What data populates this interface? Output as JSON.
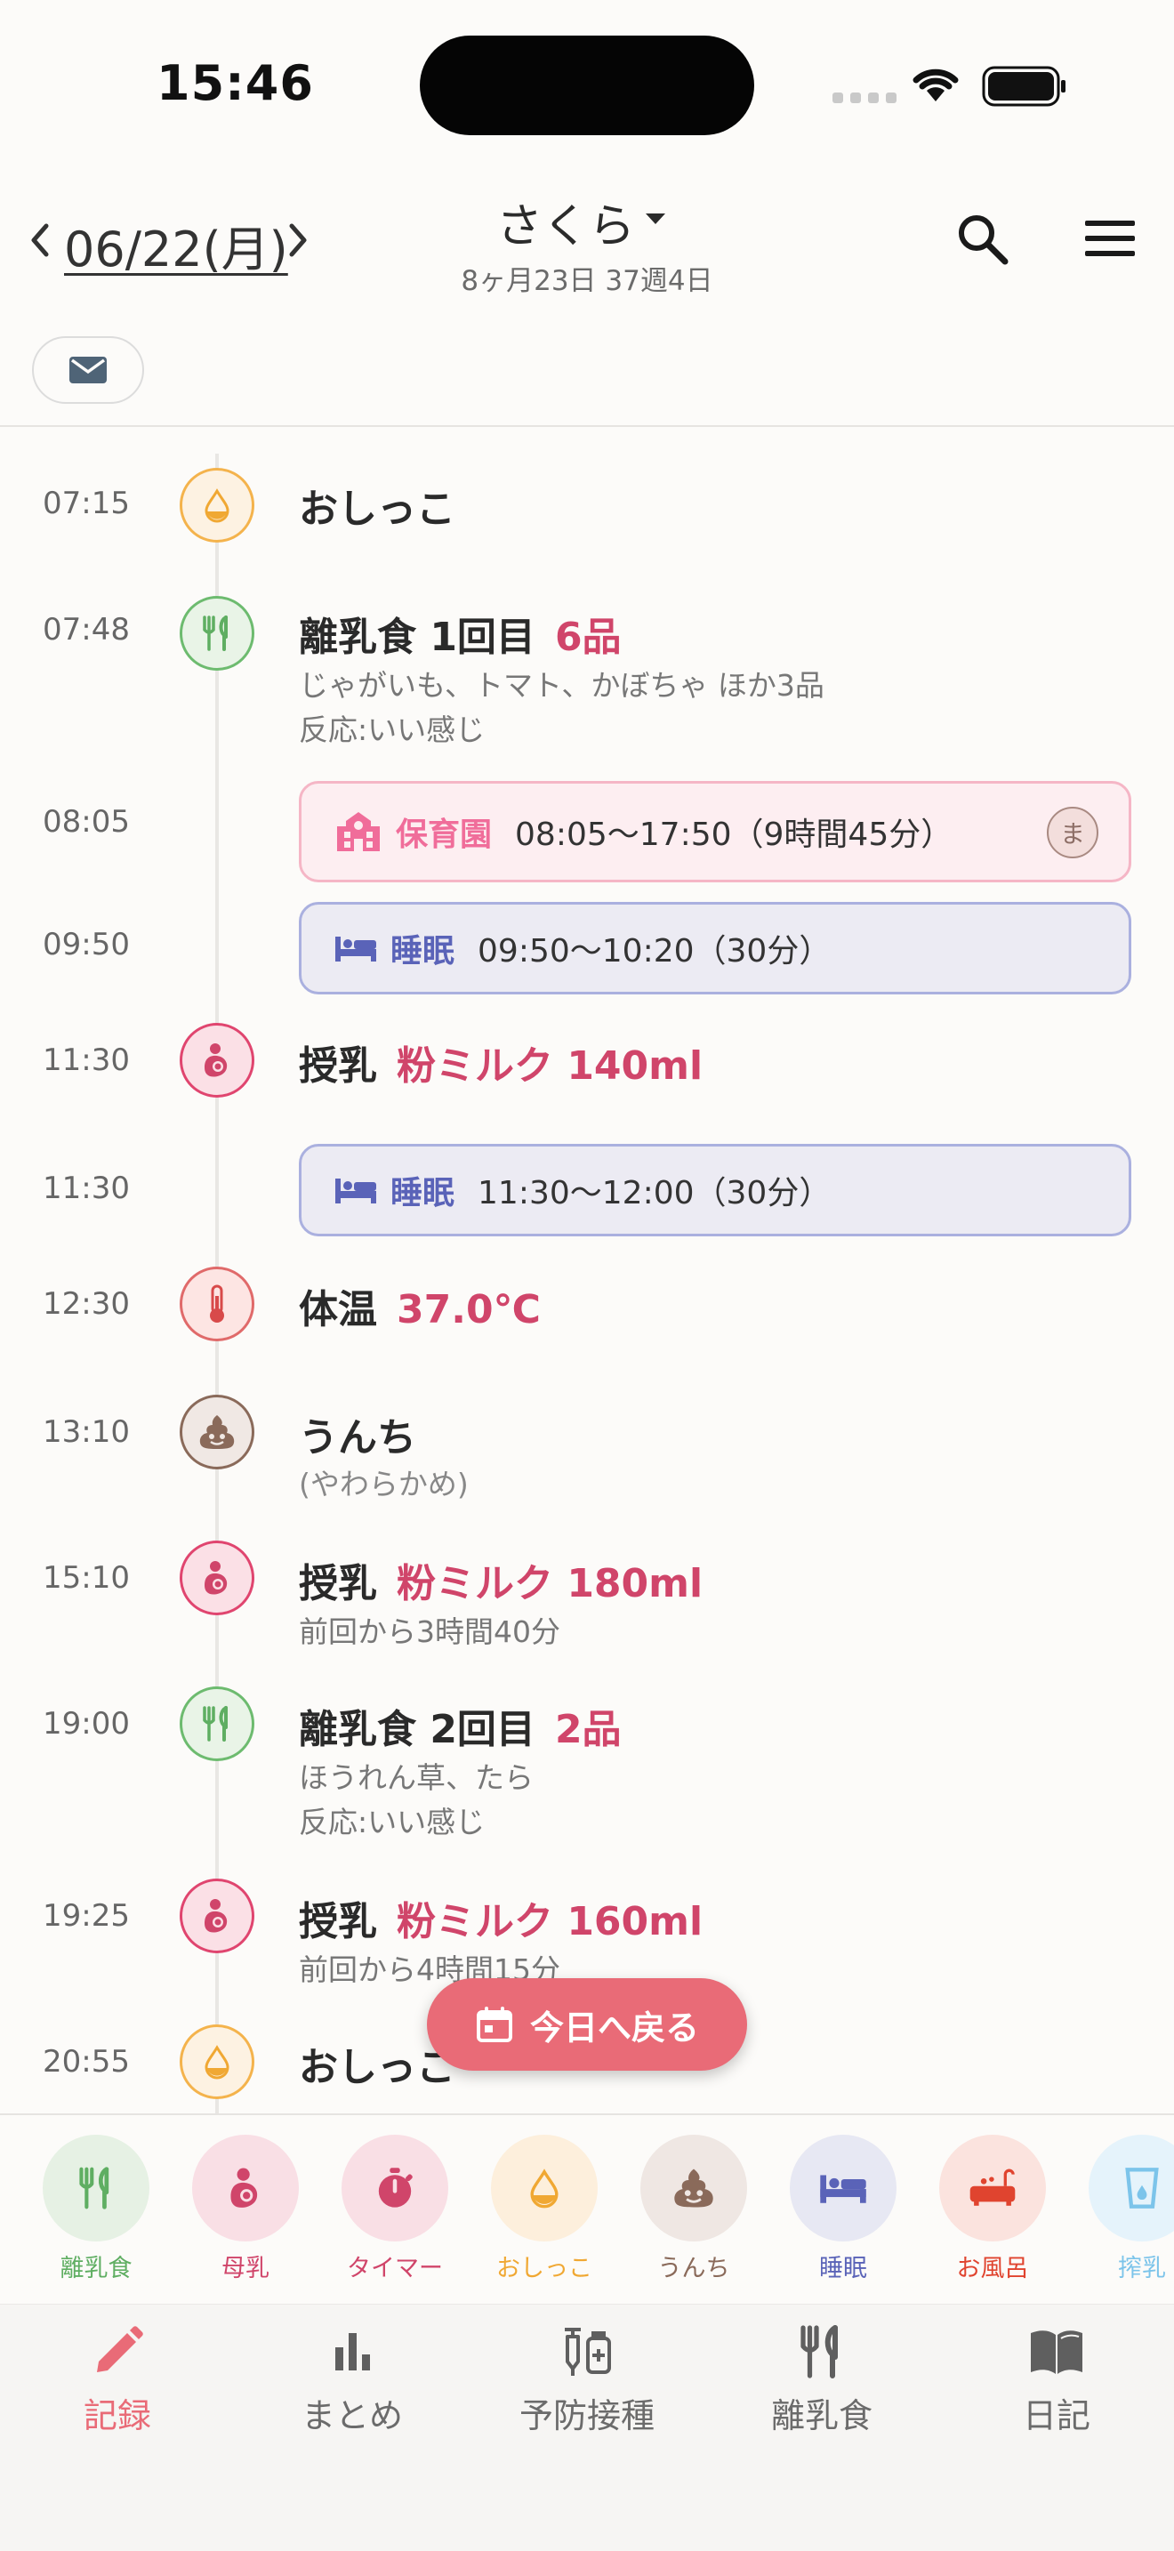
{
  "status_bar": {
    "time": "15:46"
  },
  "header": {
    "date": "06/22(月)",
    "child_name": "さくら",
    "child_age": "8ヶ月23日  37週4日"
  },
  "events": [
    {
      "time": "07:15",
      "type": "pee",
      "icon": "droplet-icon",
      "title": "おしっこ"
    },
    {
      "time": "07:48",
      "type": "baby-food",
      "icon": "fork-knife-icon",
      "title": "離乳食 1回目",
      "accent": "6品",
      "sub1": "じゃがいも、トマト、かぼちゃ ほか3品",
      "sub2": "反応:いい感じ"
    },
    {
      "time": "08:05",
      "type": "nursery",
      "icon": "school-icon",
      "label": "保育園",
      "detail": "08:05〜17:50（9時間45分）",
      "badge": "ま"
    },
    {
      "time": "09:50",
      "type": "sleep",
      "icon": "bed-icon",
      "label": "睡眠",
      "detail": "09:50〜10:20（30分）"
    },
    {
      "time": "11:30",
      "type": "feeding",
      "icon": "nursing-icon",
      "title": "授乳",
      "accent": "粉ミルク 140ml"
    },
    {
      "time": "11:30",
      "type": "sleep",
      "icon": "bed-icon",
      "label": "睡眠",
      "detail": "11:30〜12:00（30分）"
    },
    {
      "time": "12:30",
      "type": "temperature",
      "icon": "thermometer-icon",
      "title": "体温",
      "accent": "37.0℃"
    },
    {
      "time": "13:10",
      "type": "poop",
      "icon": "poop-icon",
      "title": "うんち",
      "sub1": "(やわらかめ)"
    },
    {
      "time": "15:10",
      "type": "feeding",
      "icon": "nursing-icon",
      "title": "授乳",
      "accent": "粉ミルク 180ml",
      "sub1": "前回から3時間40分"
    },
    {
      "time": "19:00",
      "type": "baby-food",
      "icon": "fork-knife-icon",
      "title": "離乳食 2回目",
      "accent": "2品",
      "sub1": "ほうれん草、たら",
      "sub2": "反応:いい感じ"
    },
    {
      "time": "19:25",
      "type": "feeding",
      "icon": "nursing-icon",
      "title": "授乳",
      "accent": "粉ミルク 160ml",
      "sub1": "前回から4時間15分"
    },
    {
      "time": "20:55",
      "type": "pee",
      "icon": "droplet-icon",
      "title": "おしっこ"
    }
  ],
  "fab": {
    "label": "今日へ戻る"
  },
  "quick_actions": [
    {
      "label": "離乳食",
      "color": "#5fae62",
      "bg": "#e6f1e4"
    },
    {
      "label": "母乳",
      "color": "#d0456a",
      "bg": "#f9dfe5"
    },
    {
      "label": "タイマー",
      "color": "#d0456a",
      "bg": "#f9dfe5"
    },
    {
      "label": "おしっこ",
      "color": "#f0a833",
      "bg": "#fdefdc"
    },
    {
      "label": "うんち",
      "color": "#8a6a5a",
      "bg": "#efe7e3"
    },
    {
      "label": "睡眠",
      "color": "#5a63b8",
      "bg": "#e7e8f3"
    },
    {
      "label": "お風呂",
      "color": "#e0442f",
      "bg": "#fbe3de"
    },
    {
      "label": "搾乳",
      "color": "#7cc4ea",
      "bg": "#e5f3fb"
    }
  ],
  "bottom_nav": [
    {
      "label": "記録",
      "active": true
    },
    {
      "label": "まとめ"
    },
    {
      "label": "予防接種"
    },
    {
      "label": "離乳食"
    },
    {
      "label": "日記"
    }
  ],
  "colors": {
    "accent": "#d0456a",
    "fab": "#e96b77",
    "sleep_border": "#aab0df",
    "sleep_bg": "#ecebf3",
    "nursery_border": "#f5b6c6",
    "nursery_bg": "#fdeef1"
  }
}
